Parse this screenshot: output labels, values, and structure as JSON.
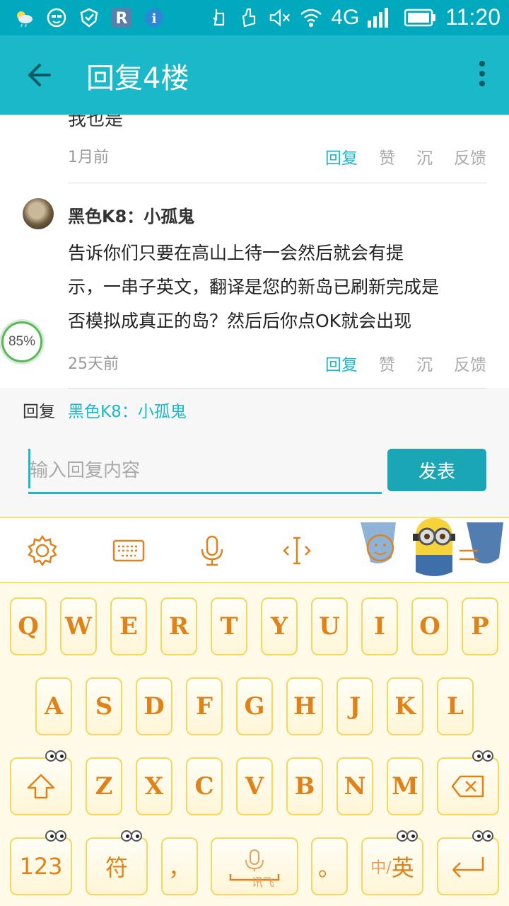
{
  "status_bar": {
    "time": "11:20",
    "network": "4G",
    "icons": [
      "weather-icon",
      "face-icon",
      "shield-icon",
      "r-app-icon",
      "info-icon",
      "touch-icon",
      "hand-icon",
      "mute-icon",
      "wifi-icon",
      "signal-icon",
      "battery-icon"
    ]
  },
  "appbar": {
    "title": "回复4楼"
  },
  "thread": {
    "partial_text": "我也是",
    "partial_time": "1月前",
    "actions": {
      "reply": "回复",
      "like": "赞",
      "sink": "沉",
      "feedback": "反馈"
    },
    "comment": {
      "author": "黑色K8：小孤鬼",
      "body_lines": [
        "告诉你们只要在高山上待一会然后就会有提",
        "示，一串子英文，翻译是您的新岛已刷新完成是",
        "否模拟成真正的岛？然后后你点OK就会出现"
      ],
      "time": "25天前"
    }
  },
  "floating_badge": "85%",
  "reply_panel": {
    "label": "回复",
    "target": "黑色K8：小孤鬼",
    "placeholder": "输入回复内容",
    "send_label": "发表"
  },
  "keyboard": {
    "row1": [
      "Q",
      "W",
      "E",
      "R",
      "T",
      "Y",
      "U",
      "I",
      "O",
      "P"
    ],
    "row2": [
      "A",
      "S",
      "D",
      "F",
      "G",
      "H",
      "J",
      "K",
      "L"
    ],
    "row3": [
      "Z",
      "X",
      "C",
      "V",
      "B",
      "N",
      "M"
    ],
    "num_label": "123",
    "symbol_label": "符",
    "comma": "，",
    "space_sub": "讯飞",
    "period": "。",
    "lang_cn": "中/",
    "lang_en": "英",
    "accent": "#e0821a"
  }
}
